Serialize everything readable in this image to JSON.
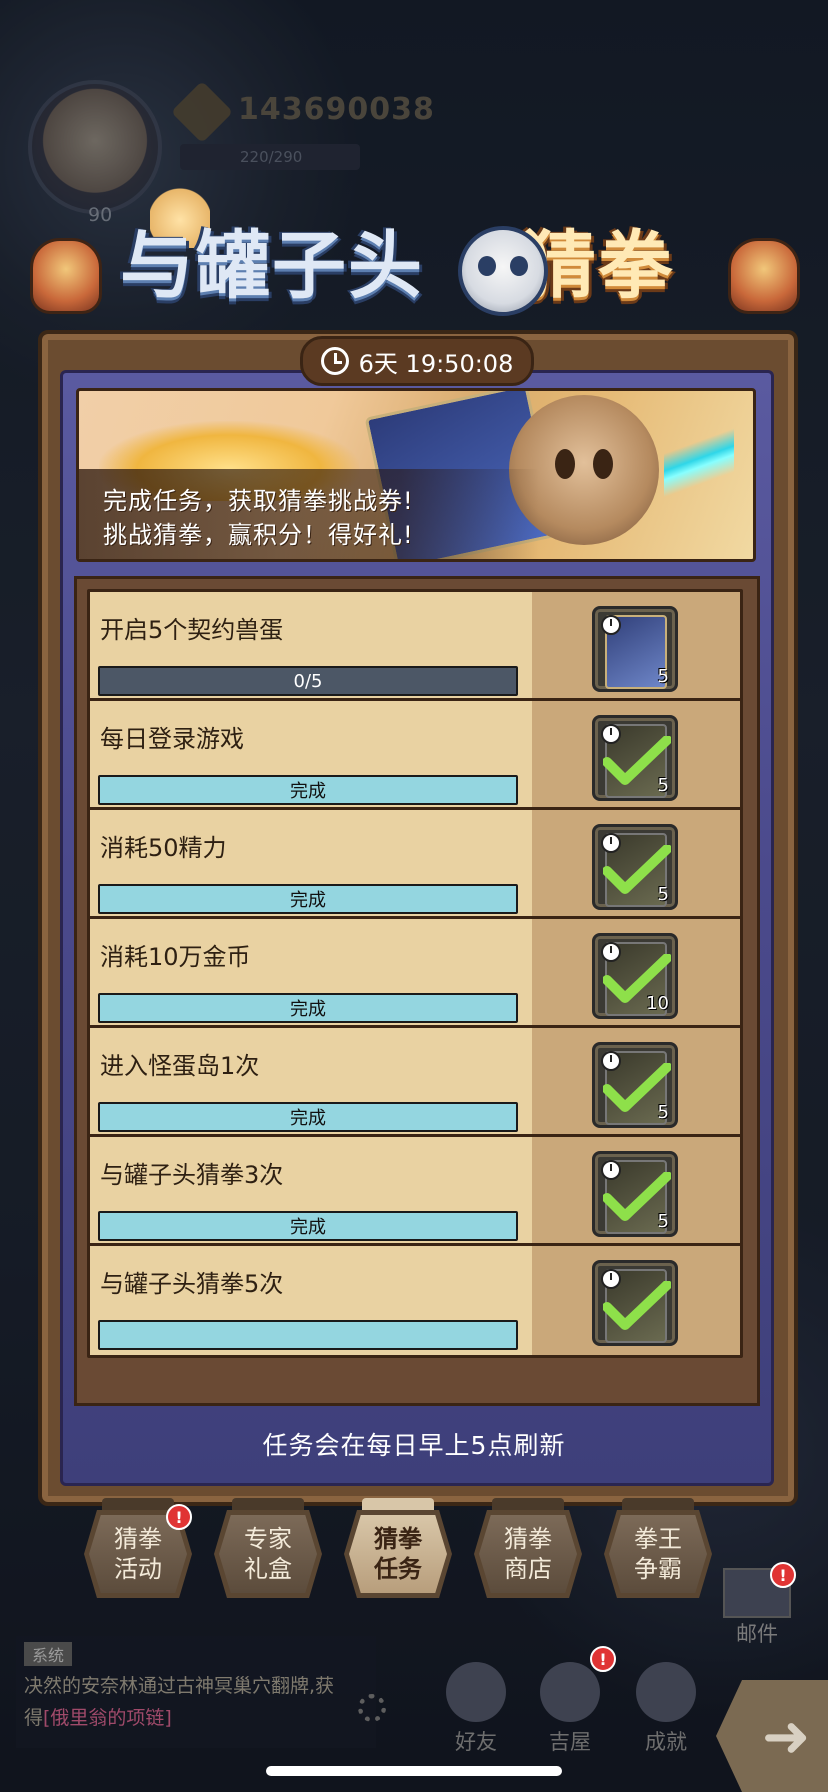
{
  "hud": {
    "power": "143690038",
    "energy": "220/290",
    "level": "90"
  },
  "event": {
    "title_cool": "与罐子头",
    "title_warm": "猜拳",
    "timer": "6天 19:50:08",
    "banner_line1": "完成任务，获取猜拳挑战券!",
    "banner_line2": "挑战猜拳，赢积分！得好礼!"
  },
  "tasks": [
    {
      "title": "开启5个契约兽蛋",
      "status": "0/5",
      "state": "in-progress",
      "progress": 0.0,
      "reward_qty": "5"
    },
    {
      "title": "每日登录游戏",
      "status": "完成",
      "state": "done",
      "progress": 1.0,
      "reward_qty": "5"
    },
    {
      "title": "消耗50精力",
      "status": "完成",
      "state": "done",
      "progress": 1.0,
      "reward_qty": "5"
    },
    {
      "title": "消耗10万金币",
      "status": "完成",
      "state": "done",
      "progress": 1.0,
      "reward_qty": "10"
    },
    {
      "title": "进入怪蛋岛1次",
      "status": "完成",
      "state": "done",
      "progress": 1.0,
      "reward_qty": "5"
    },
    {
      "title": "与罐子头猜拳3次",
      "status": "完成",
      "state": "done",
      "progress": 1.0,
      "reward_qty": "5"
    },
    {
      "title": "与罐子头猜拳5次",
      "status": "",
      "state": "done",
      "progress": 1.0,
      "reward_qty": ""
    }
  ],
  "refresh_note": "任务会在每日早上5点刷新",
  "tabs": [
    {
      "label": "猜拳活动",
      "line1": "猜拳",
      "line2": "活动",
      "active": false,
      "badge": "!"
    },
    {
      "label": "专家礼盒",
      "line1": "专家",
      "line2": "礼盒",
      "active": false,
      "badge": ""
    },
    {
      "label": "猜拳任务",
      "line1": "猜拳",
      "line2": "任务",
      "active": true,
      "badge": ""
    },
    {
      "label": "猜拳商店",
      "line1": "猜拳",
      "line2": "商店",
      "active": false,
      "badge": ""
    },
    {
      "label": "拳王争霸",
      "line1": "拳王",
      "line2": "争霸",
      "active": false,
      "badge": ""
    }
  ],
  "chat": {
    "tag": "系统",
    "message_prefix": "决然的安奈林通过古神冥巢穴翻牌,获得",
    "message_item": "[俄里翁的项链]"
  },
  "bottom_nav": {
    "friends": "好友",
    "house": "吉屋",
    "achievements": "成就",
    "mail": "邮件"
  },
  "colors": {
    "task_done_bar": "#94d6e0",
    "task_progress_bar": "#4c5766",
    "panel_purple": "#4b4a8c",
    "frame_brown": "#6b4c30",
    "check_green": "#8ee04a"
  }
}
